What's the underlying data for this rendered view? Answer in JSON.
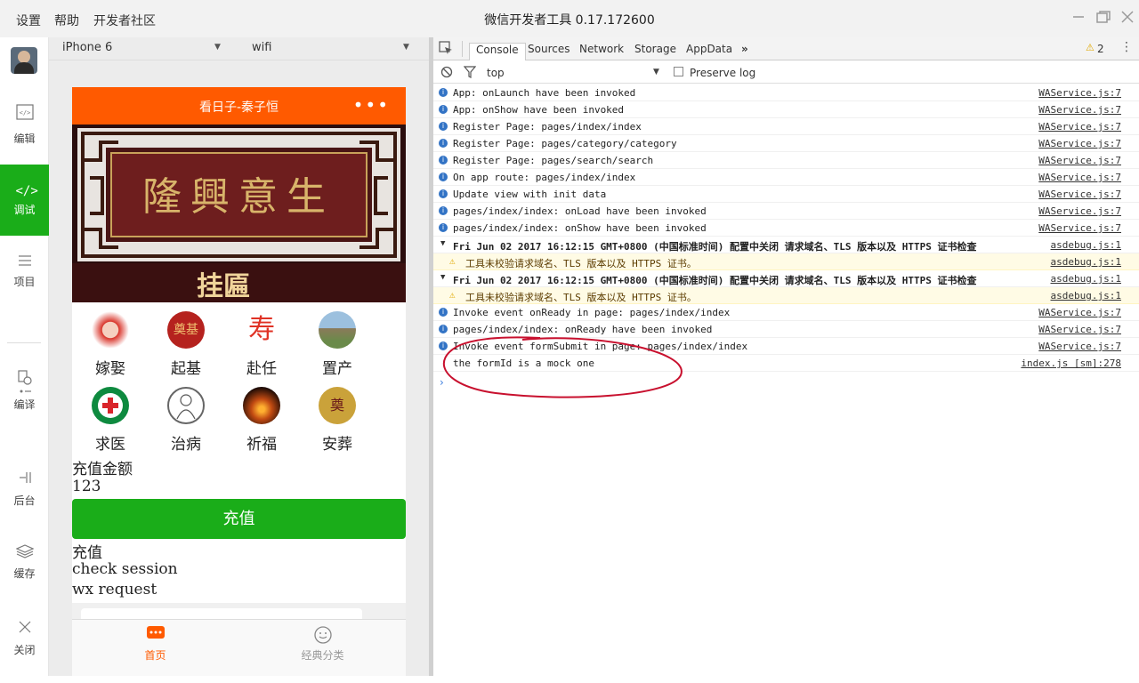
{
  "titlebar": {
    "menus": [
      "设置",
      "帮助",
      "开发者社区"
    ],
    "title": "微信开发者工具 0.17.172600"
  },
  "sidebar": {
    "items": [
      {
        "label": "编辑",
        "icon": "code-icon"
      },
      {
        "label": "调试",
        "icon": "debug-icon"
      },
      {
        "label": "项目",
        "icon": "menu-icon"
      },
      {
        "label": "编译",
        "icon": "compile-icon"
      },
      {
        "label": "后台",
        "icon": "background-icon"
      },
      {
        "label": "缓存",
        "icon": "layers-icon"
      },
      {
        "label": "关闭",
        "icon": "close-icon"
      }
    ]
  },
  "simulator": {
    "device": "iPhone 6",
    "network": "wifi",
    "nav_title": "看日子-秦子恒",
    "nav_dots": "•••",
    "banner_label": "挂匾",
    "grid": [
      {
        "label": "嫁娶",
        "color": "#d9352b"
      },
      {
        "label": "起基",
        "color": "#b5221e"
      },
      {
        "label": "赴任",
        "color": "#e03225"
      },
      {
        "label": "置产",
        "color": "#7a6a4a"
      },
      {
        "label": "求医",
        "color": "#0e8a3f"
      },
      {
        "label": "治病",
        "color": "#9a9a9a"
      },
      {
        "label": "祈福",
        "color": "#c14a12"
      },
      {
        "label": "安葬",
        "color": "#caa23a"
      }
    ],
    "amount_label": "充值金额",
    "amount_value": "123",
    "pay_button": "充值",
    "lines": [
      "充值",
      "check session",
      "wx request"
    ],
    "tabs": [
      {
        "label": "首页",
        "color": "#ff5a00"
      },
      {
        "label": "经典分类",
        "color": "#999999"
      }
    ]
  },
  "devtools": {
    "tabs": [
      "Console",
      "Sources",
      "Network",
      "Storage",
      "AppData"
    ],
    "warn_count": "2",
    "filter_context": "top",
    "preserve_log": "Preserve log",
    "logs": [
      {
        "type": "info",
        "msg": "App: onLaunch have been invoked",
        "src": "WAService.js:7"
      },
      {
        "type": "info",
        "msg": "App: onShow have been invoked",
        "src": "WAService.js:7"
      },
      {
        "type": "info",
        "msg": "Register Page: pages/index/index",
        "src": "WAService.js:7"
      },
      {
        "type": "info",
        "msg": "Register Page: pages/category/category",
        "src": "WAService.js:7"
      },
      {
        "type": "info",
        "msg": "Register Page: pages/search/search",
        "src": "WAService.js:7"
      },
      {
        "type": "info",
        "msg": "On app route: pages/index/index",
        "src": "WAService.js:7"
      },
      {
        "type": "info",
        "msg": "Update view with init data",
        "src": "WAService.js:7"
      },
      {
        "type": "info",
        "msg": "pages/index/index: onLoad have been invoked",
        "src": "WAService.js:7"
      },
      {
        "type": "info",
        "msg": "pages/index/index: onShow have been invoked",
        "src": "WAService.js:7"
      },
      {
        "type": "group",
        "msg": "Fri Jun 02 2017 16:12:15 GMT+0800 (中国标准时间) 配置中关闭 请求域名、TLS 版本以及 HTTPS 证书检查",
        "src": "asdebug.js:1"
      },
      {
        "type": "warn",
        "msg": "工具未校验请求域名、TLS 版本以及 HTTPS 证书。",
        "src": "asdebug.js:1"
      },
      {
        "type": "group",
        "msg": "Fri Jun 02 2017 16:12:15 GMT+0800 (中国标准时间) 配置中关闭 请求域名、TLS 版本以及 HTTPS 证书检查",
        "src": "asdebug.js:1"
      },
      {
        "type": "warn",
        "msg": "工具未校验请求域名、TLS 版本以及 HTTPS 证书。",
        "src": "asdebug.js:1"
      },
      {
        "type": "info",
        "msg": "Invoke event onReady in page: pages/index/index",
        "src": "WAService.js:7"
      },
      {
        "type": "info",
        "msg": "pages/index/index: onReady have been invoked",
        "src": "WAService.js:7"
      },
      {
        "type": "info",
        "msg": "Invoke event formSubmit in page: pages/index/index",
        "src": "WAService.js:7"
      },
      {
        "type": "plain",
        "msg": "the formId is a mock one",
        "src": "index.js [sm]:278"
      }
    ]
  },
  "colors": {
    "accent_green": "#1aad19",
    "nav_orange": "#ff5a00",
    "annotation_red": "#c8102e"
  }
}
